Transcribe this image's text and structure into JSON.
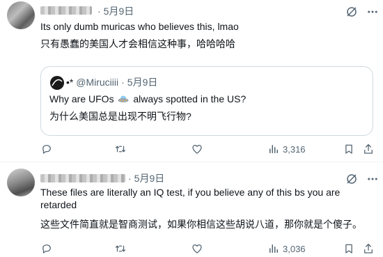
{
  "tweets": [
    {
      "date": "5月9日",
      "text_en": "Its only dumb muricas who believes this, lmao",
      "text_zh": "只有愚蠢的美国人才会相信这种事，哈哈哈哈",
      "quote": {
        "handle": "@Miruciiii",
        "date": "5月9日",
        "text_en_before": "Why are UFOs",
        "text_en_after": "always spotted in the US?",
        "text_zh": "为什么美国总是出现不明飞行物?"
      },
      "views": "3,316"
    },
    {
      "date": "5月9日",
      "text_en_line1": "These files are literally an IQ test, if you believe any of this bs you are",
      "text_en_line2": "retarded",
      "text_zh": "这些文件简直就是智商测试，如果你相信这些胡说八道，那你就是个傻子。",
      "views": "3,036"
    }
  ],
  "separator": "·",
  "icons": [
    "grok-icon",
    "more-icon",
    "reply-icon",
    "retweet-icon",
    "like-icon",
    "views-icon",
    "bookmark-icon"
  ],
  "colors": {
    "text": "#0f1419",
    "muted": "#536471",
    "border": "#cfd9de"
  }
}
